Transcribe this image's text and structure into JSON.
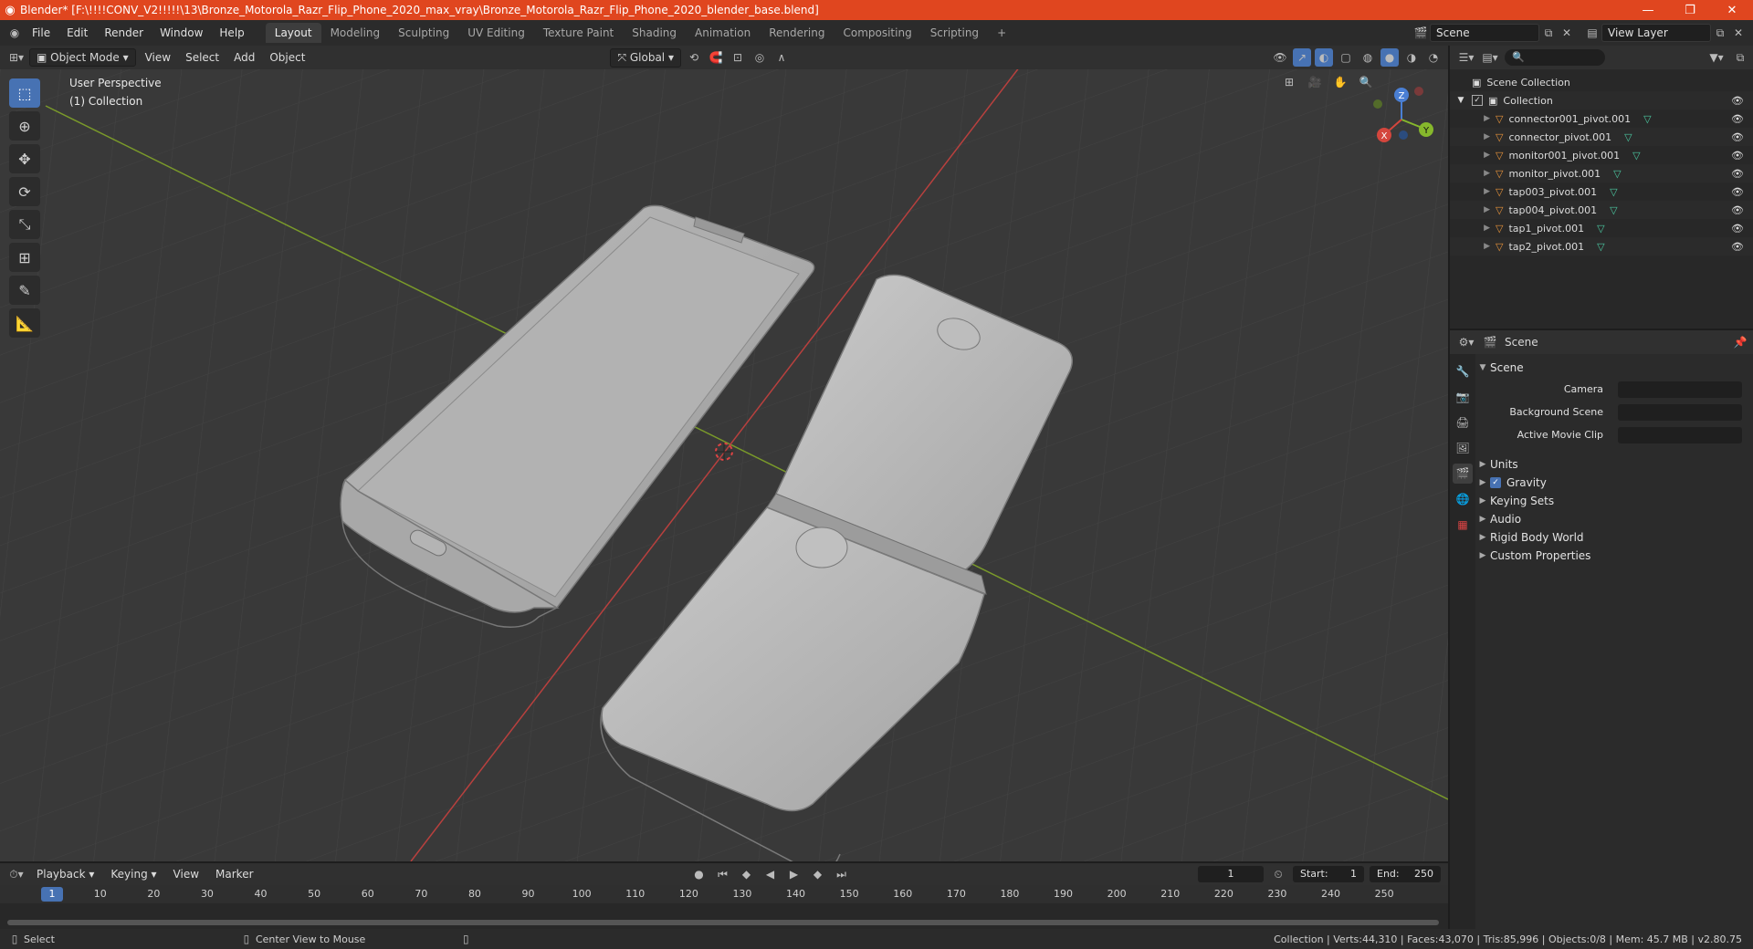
{
  "window": {
    "title": "Blender* [F:\\!!!!CONV_V2!!!!!\\13\\Bronze_Motorola_Razr_Flip_Phone_2020_max_vray\\Bronze_Motorola_Razr_Flip_Phone_2020_blender_base.blend]",
    "minimize": "—",
    "maximize": "❐",
    "close": "✕"
  },
  "menus": [
    "File",
    "Edit",
    "Render",
    "Window",
    "Help"
  ],
  "workspaces": [
    "Layout",
    "Modeling",
    "Sculpting",
    "UV Editing",
    "Texture Paint",
    "Shading",
    "Animation",
    "Rendering",
    "Compositing",
    "Scripting"
  ],
  "add_tab": "+",
  "scene_name": "Scene",
  "view_layer": "View Layer",
  "viewport_header": {
    "mode": "Object Mode",
    "menus": [
      "View",
      "Select",
      "Add",
      "Object"
    ],
    "orientation": "Global"
  },
  "viewport": {
    "perspective": "User Perspective",
    "collection": "(1) Collection",
    "gizmo": {
      "x": "X",
      "y": "Y",
      "z": "Z"
    }
  },
  "tools": [
    "select-box-tool",
    "cursor-tool",
    "move-tool",
    "rotate-tool",
    "scale-tool",
    "transform-tool",
    "annotate-tool",
    "measure-tool"
  ],
  "timeline": {
    "menus": [
      "Playback",
      "Keying",
      "View",
      "Marker"
    ],
    "current_frame": "1",
    "start_label": "Start:",
    "start": "1",
    "end_label": "End:",
    "end": "250",
    "ticks": [
      "1",
      "10",
      "20",
      "30",
      "40",
      "50",
      "60",
      "70",
      "80",
      "90",
      "100",
      "110",
      "120",
      "130",
      "140",
      "150",
      "160",
      "170",
      "180",
      "190",
      "200",
      "210",
      "220",
      "230",
      "240",
      "250"
    ]
  },
  "status": {
    "select": "Select",
    "center": "Center View to Mouse",
    "stats": "Collection | Verts:44,310 | Faces:43,070 | Tris:85,996 | Objects:0/8 | Mem: 45.7 MB | v2.80.75"
  },
  "outliner": {
    "root": "Scene Collection",
    "collection": "Collection",
    "objects": [
      "connector001_pivot.001",
      "connector_pivot.001",
      "monitor001_pivot.001",
      "monitor_pivot.001",
      "tap003_pivot.001",
      "tap004_pivot.001",
      "tap1_pivot.001",
      "tap2_pivot.001"
    ]
  },
  "properties": {
    "context": "Scene",
    "panel": "Scene",
    "camera_label": "Camera",
    "background_label": "Background Scene",
    "movieclip_label": "Active Movie Clip",
    "subpanels": [
      "Units",
      "Gravity",
      "Keying Sets",
      "Audio",
      "Rigid Body World",
      "Custom Properties"
    ]
  }
}
